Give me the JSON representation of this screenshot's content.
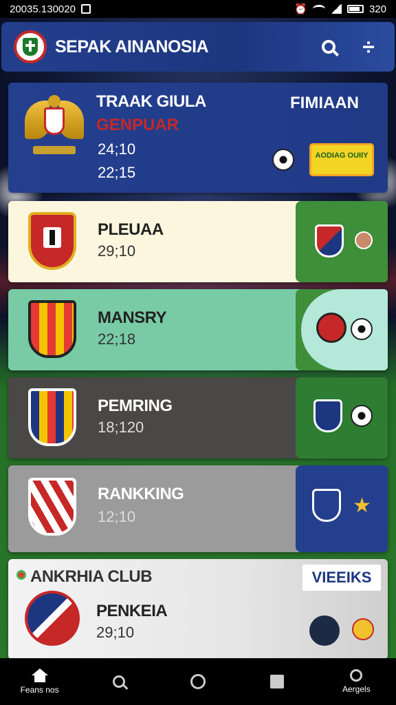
{
  "status_bar": {
    "time_left": "20035.130020",
    "time_right": "320"
  },
  "header": {
    "title": "SEPAK AINANOSIA",
    "menu_symbol": "÷"
  },
  "cards": [
    {
      "name": "TRAAK GIULA",
      "subtitle": "GENPUAR",
      "score1": "24;10",
      "score2": "22;15",
      "tag": "FIMIAAN",
      "chip": "AODIAG OUIIY"
    },
    {
      "name": "PLEUAA",
      "score": "29;10"
    },
    {
      "name": "MANSRY",
      "score": "22;18"
    },
    {
      "name": "PEMRING",
      "score": "18;120"
    },
    {
      "name": "RANKKING",
      "score": "12;10"
    },
    {
      "club": "ANKRHIA CLUB",
      "name": "PENKEIA",
      "score": "29;10",
      "button": "VIEEIKS"
    }
  ],
  "bottom_nav": [
    {
      "label": "Feans nos",
      "icon": "home-icon"
    },
    {
      "label": "",
      "icon": "search-icon"
    },
    {
      "label": "",
      "icon": "circle-icon"
    },
    {
      "label": "",
      "icon": "square-icon"
    },
    {
      "label": "Aergels",
      "icon": "person-icon"
    }
  ],
  "colors": {
    "header": "#233f8c",
    "accent_red": "#c62828",
    "green": "#3e8e3a",
    "chip": "#f2d524"
  }
}
